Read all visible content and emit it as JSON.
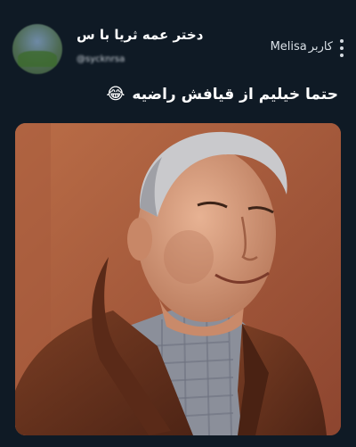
{
  "tweet": {
    "display_name": "دختر عمه ثریا با س",
    "handle": "@sycknrsa",
    "watermark_label": "کاربر",
    "watermark_name": "Melisa",
    "text": "حتما خیلیم از قیافش راضیه",
    "emoji": "😂"
  },
  "colors": {
    "background": "#0f1a25",
    "photo_background": "#a7573a",
    "jacket": "#6b3520"
  }
}
